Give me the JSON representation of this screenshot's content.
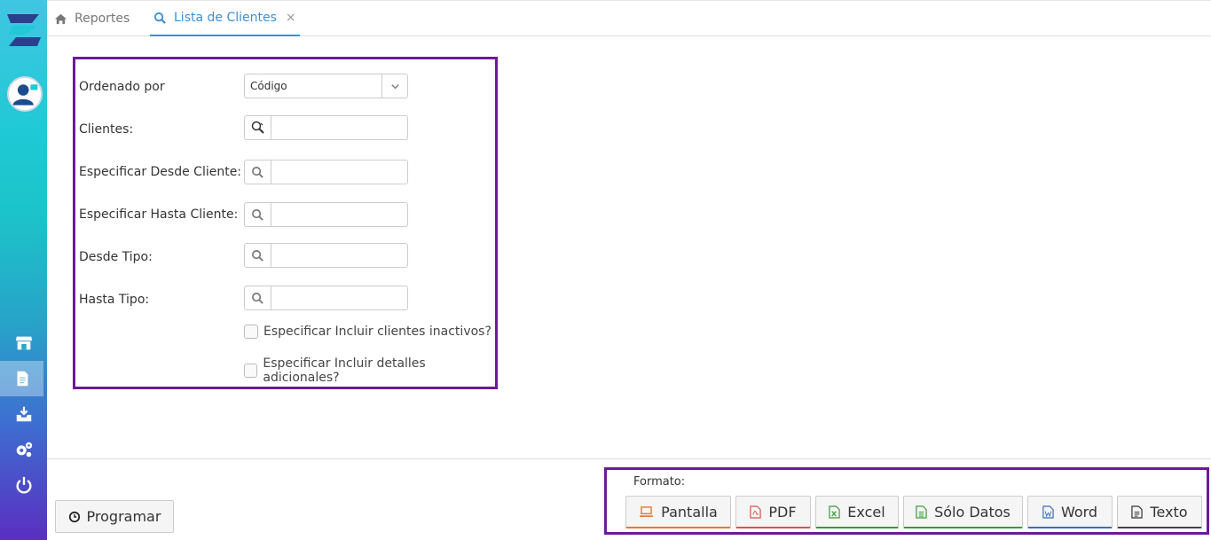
{
  "tabs": {
    "home_label": "Reportes",
    "active_label": "Lista de Clientes",
    "close_glyph": "×"
  },
  "form": {
    "order_label": "Ordenado por",
    "order_value": "Código",
    "clientes_label": "Clientes:",
    "desde_cliente_label": "Especificar Desde Cliente:",
    "hasta_cliente_label": "Especificar Hasta Cliente:",
    "desde_tipo_label": "Desde Tipo:",
    "hasta_tipo_label": "Hasta Tipo:",
    "check_inactivos": "Especificar Incluir clientes inactivos?",
    "check_detalles": "Especificar Incluir detalles adicionales?"
  },
  "bottom": {
    "programar_label": "Programar",
    "formato_label": "Formato:",
    "buttons": {
      "pantalla": "Pantalla",
      "pdf": "PDF",
      "excel": "Excel",
      "solo_datos": "Sólo Datos",
      "word": "Word",
      "texto": "Texto"
    }
  },
  "colors": {
    "accent": "#3a8fd8",
    "panel_border": "#6a1b9a",
    "sidebar_top": "#40c6e2",
    "sidebar_bottom": "#5a2fc2"
  }
}
